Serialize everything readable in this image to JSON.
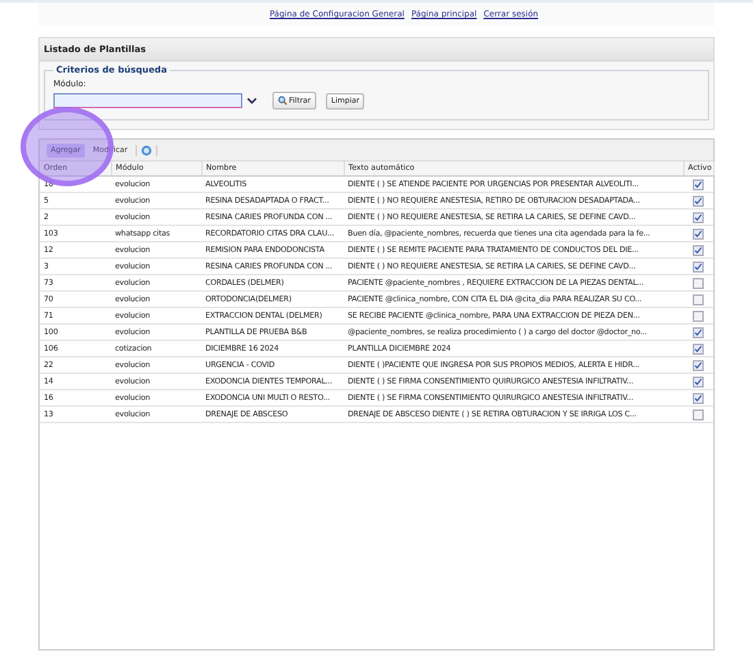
{
  "top_links": [
    "Página de Configuracion General",
    "Página principal",
    "Cerrar sesión"
  ],
  "panel": {
    "title": "Listado de Plantillas",
    "legend": "Criterios de búsqueda",
    "field_label": "Módulo:",
    "buttons": [
      "Filtrar",
      "Limpiar"
    ]
  },
  "toolbar": {
    "buttons": [
      {
        "label": "Agregar",
        "selected": true
      },
      {
        "label": "Modificar",
        "selected": false
      }
    ]
  },
  "table": {
    "columns": [
      "Orden",
      "Módulo",
      "Nombre",
      "Texto automático",
      "Activo"
    ],
    "rows": [
      {
        "orden": "18",
        "modulo": "evolucion",
        "nombre": "ALVEOLITIS",
        "texto": "DIENTE ( ) SE ATIENDE PACIENTE POR URGENCIAS POR PRESENTAR ALVEOLITI...",
        "activo": true
      },
      {
        "orden": "5",
        "modulo": "evolucion",
        "nombre": "RESINA DESADAPTADA O FRACT...",
        "texto": "DIENTE ( ) NO REQUIERE ANESTESIA, RETIRO DE OBTURACION DESADAPTADA...",
        "activo": true
      },
      {
        "orden": "2",
        "modulo": "evolucion",
        "nombre": "RESINA CARIES PROFUNDA CON ...",
        "texto": "DIENTE ( ) NO REQUIERE ANESTESIA, SE RETIRA LA CARIES, SE DEFINE CAVD...",
        "activo": true
      },
      {
        "orden": "103",
        "modulo": "whatsapp citas",
        "nombre": "RECORDATORIO CITAS DRA CLAU...",
        "texto": "Buen día, @paciente_nombres, recuerda que tienes una cita agendada para la fe...",
        "activo": true
      },
      {
        "orden": "12",
        "modulo": "evolucion",
        "nombre": "REMISION PARA ENDODONCISTA",
        "texto": "DIENTE ( ) SE REMITE PACIENTE PARA TRATAMIENTO DE CONDUCTOS DEL DIE...",
        "activo": true
      },
      {
        "orden": "3",
        "modulo": "evolucion",
        "nombre": "RESINA CARIES PROFUNDA CON ...",
        "texto": "DIENTE ( ) NO REQUIERE ANESTESIA, SE RETIRA LA CARIES, SE DEFINE CAVD...",
        "activo": true
      },
      {
        "orden": "73",
        "modulo": "evolucion",
        "nombre": "CORDALES (DELMER)",
        "texto": "PACIENTE @paciente_nombres , REQUIERE EXTRACCION DE LA PIEZAS DENTAL...",
        "activo": false
      },
      {
        "orden": "70",
        "modulo": "evolucion",
        "nombre": "ORTODONCIA(DELMER)",
        "texto": "PACIENTE @clinica_nombre, CON CITA EL DIA @cita_dia PARA REALIZAR SU CO...",
        "activo": false
      },
      {
        "orden": "71",
        "modulo": "evolucion",
        "nombre": "EXTRACCION DENTAL (DELMER)",
        "texto": "SE RECIBE PACIENTE @clinica_nombre, PARA UNA EXTRACCION DE PIEZA DEN...",
        "activo": false
      },
      {
        "orden": "100",
        "modulo": "evolucion",
        "nombre": "PLANTILLA DE PRUEBA B&B",
        "texto": "@paciente_nombres, se realiza procedimiento ( ) a cargo del doctor @doctor_no...",
        "activo": true
      },
      {
        "orden": "106",
        "modulo": "cotizacion",
        "nombre": "DICIEMBRE 16 2024",
        "texto": "PLANTILLA DICIEMBRE 2024",
        "activo": true
      },
      {
        "orden": "22",
        "modulo": "evolucion",
        "nombre": "URGENCIA - COVID",
        "texto": "DIENTE ( )PACIENTE QUE INGRESA POR SUS PROPIOS MEDIOS, ALERTA E HIDR...",
        "activo": true
      },
      {
        "orden": "14",
        "modulo": "evolucion",
        "nombre": "EXODONCIA DIENTES TEMPORAL...",
        "texto": "DIENTE ( ) SE FIRMA CONSENTIMIENTO QUIRURGICO ANESTESIA INFILTRATIV...",
        "activo": true
      },
      {
        "orden": "16",
        "modulo": "evolucion",
        "nombre": "EXODONCIA UNI MULTI O RESTO...",
        "texto": "DIENTE ( ) SE FIRMA CONSENTIMIENTO QUIRURGICO ANESTESIA INFILTRATIV...",
        "activo": true
      },
      {
        "orden": "13",
        "modulo": "evolucion",
        "nombre": "DRENAJE DE ABSCESO",
        "texto": "DRENAJE DE ABSCESO DIENTE ( ) SE RETIRA OBTURACION Y SE IRRIGA LOS C...",
        "activo": false
      }
    ]
  }
}
